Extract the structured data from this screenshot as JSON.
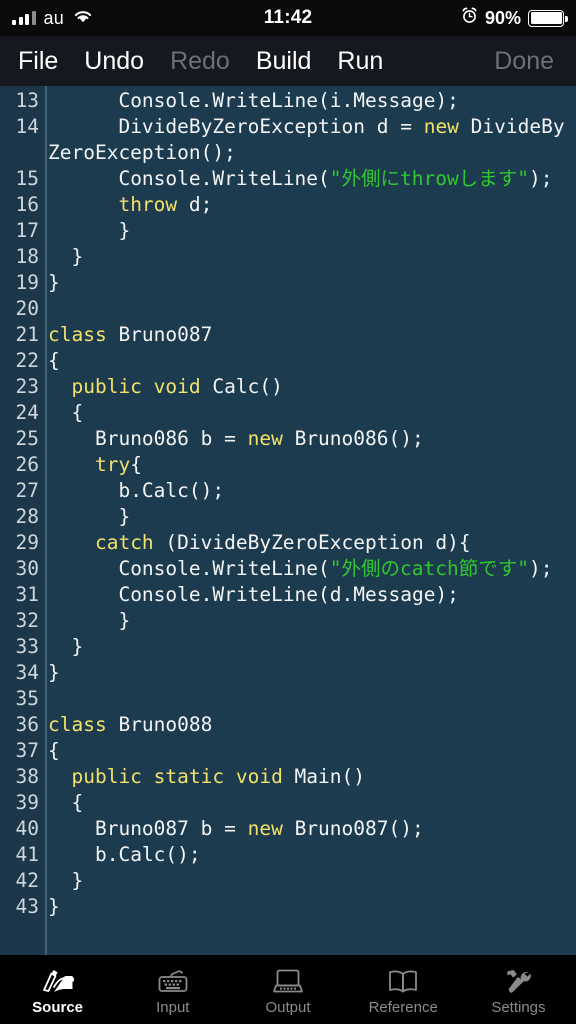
{
  "status_bar": {
    "carrier": "au",
    "time": "11:42",
    "battery_percent": "90%",
    "signal_icon": "signal-bars-icon",
    "wifi_icon": "wifi-icon",
    "alarm_icon": "alarm-clock-icon",
    "battery_icon": "battery-icon",
    "background": "#0a0a0a"
  },
  "toolbar": {
    "background": "#16181f",
    "items": [
      {
        "label": "File",
        "enabled": true
      },
      {
        "label": "Undo",
        "enabled": true
      },
      {
        "label": "Redo",
        "enabled": false
      },
      {
        "label": "Build",
        "enabled": true
      },
      {
        "label": "Run",
        "enabled": true
      }
    ],
    "done_label": "Done",
    "done_enabled": false
  },
  "editor": {
    "background": "#1d3b4e",
    "gutter_background": "#1b3749",
    "keyword_color": "#f2e06a",
    "string_color": "#2fc72f",
    "text_color": "#f2f4f5",
    "line_number_color": "#cfd6da",
    "language": "C#",
    "first_visible_line": 13,
    "last_visible_line": 43,
    "lines": [
      {
        "n": "13",
        "tokens": [
          {
            "t": "p",
            "v": "      Console.WriteLine(i.Message);"
          }
        ]
      },
      {
        "n": "14",
        "tokens": [
          {
            "t": "p",
            "v": "      DivideByZeroException d = "
          },
          {
            "t": "k",
            "v": "new"
          },
          {
            "t": "p",
            "v": " DivideByZeroException();"
          }
        ]
      },
      {
        "n": "15",
        "tokens": [
          {
            "t": "p",
            "v": "      Console.WriteLine("
          },
          {
            "t": "s",
            "v": "\"外側にthrowします\""
          },
          {
            "t": "p",
            "v": ");"
          }
        ]
      },
      {
        "n": "16",
        "tokens": [
          {
            "t": "k",
            "v": "      throw"
          },
          {
            "t": "p",
            "v": " d;"
          }
        ]
      },
      {
        "n": "17",
        "tokens": [
          {
            "t": "p",
            "v": "      }"
          }
        ]
      },
      {
        "n": "18",
        "tokens": [
          {
            "t": "p",
            "v": "  }"
          }
        ]
      },
      {
        "n": "19",
        "tokens": [
          {
            "t": "p",
            "v": "}"
          }
        ]
      },
      {
        "n": "20",
        "tokens": [
          {
            "t": "p",
            "v": ""
          }
        ]
      },
      {
        "n": "21",
        "tokens": [
          {
            "t": "k",
            "v": "class"
          },
          {
            "t": "p",
            "v": " Bruno087"
          }
        ]
      },
      {
        "n": "22",
        "tokens": [
          {
            "t": "p",
            "v": "{"
          }
        ]
      },
      {
        "n": "23",
        "tokens": [
          {
            "t": "k",
            "v": "  public void"
          },
          {
            "t": "p",
            "v": " Calc()"
          }
        ]
      },
      {
        "n": "24",
        "tokens": [
          {
            "t": "p",
            "v": "  {"
          }
        ]
      },
      {
        "n": "25",
        "tokens": [
          {
            "t": "p",
            "v": "    Bruno086 b = "
          },
          {
            "t": "k",
            "v": "new"
          },
          {
            "t": "p",
            "v": " Bruno086();"
          }
        ]
      },
      {
        "n": "26",
        "tokens": [
          {
            "t": "k",
            "v": "    try"
          },
          {
            "t": "p",
            "v": "{"
          }
        ]
      },
      {
        "n": "27",
        "tokens": [
          {
            "t": "p",
            "v": "      b.Calc();"
          }
        ]
      },
      {
        "n": "28",
        "tokens": [
          {
            "t": "p",
            "v": "      }"
          }
        ]
      },
      {
        "n": "29",
        "tokens": [
          {
            "t": "k",
            "v": "    catch"
          },
          {
            "t": "p",
            "v": " (DivideByZeroException d){"
          }
        ]
      },
      {
        "n": "30",
        "tokens": [
          {
            "t": "p",
            "v": "      Console.WriteLine("
          },
          {
            "t": "s",
            "v": "\"外側のcatch節です\""
          },
          {
            "t": "p",
            "v": ");"
          }
        ]
      },
      {
        "n": "31",
        "tokens": [
          {
            "t": "p",
            "v": "      Console.WriteLine(d.Message);"
          }
        ]
      },
      {
        "n": "32",
        "tokens": [
          {
            "t": "p",
            "v": "      }"
          }
        ]
      },
      {
        "n": "33",
        "tokens": [
          {
            "t": "p",
            "v": "  }"
          }
        ]
      },
      {
        "n": "34",
        "tokens": [
          {
            "t": "p",
            "v": "}"
          }
        ]
      },
      {
        "n": "35",
        "tokens": [
          {
            "t": "p",
            "v": ""
          }
        ]
      },
      {
        "n": "36",
        "tokens": [
          {
            "t": "k",
            "v": "class"
          },
          {
            "t": "p",
            "v": " Bruno088"
          }
        ]
      },
      {
        "n": "37",
        "tokens": [
          {
            "t": "p",
            "v": "{"
          }
        ]
      },
      {
        "n": "38",
        "tokens": [
          {
            "t": "k",
            "v": "  public static void"
          },
          {
            "t": "p",
            "v": " Main()"
          }
        ]
      },
      {
        "n": "39",
        "tokens": [
          {
            "t": "p",
            "v": "  {"
          }
        ]
      },
      {
        "n": "40",
        "tokens": [
          {
            "t": "p",
            "v": "    Bruno087 b = "
          },
          {
            "t": "k",
            "v": "new"
          },
          {
            "t": "p",
            "v": " Bruno087();"
          }
        ]
      },
      {
        "n": "41",
        "tokens": [
          {
            "t": "p",
            "v": "    b.Calc();"
          }
        ]
      },
      {
        "n": "42",
        "tokens": [
          {
            "t": "p",
            "v": "  }"
          }
        ]
      },
      {
        "n": "43",
        "tokens": [
          {
            "t": "p",
            "v": "}"
          }
        ]
      }
    ]
  },
  "tabbar": {
    "background": "#000000",
    "active_index": 0,
    "tabs": [
      {
        "label": "Source",
        "icon": "writing-hand-icon"
      },
      {
        "label": "Input",
        "icon": "keyboard-icon"
      },
      {
        "label": "Output",
        "icon": "computer-icon"
      },
      {
        "label": "Reference",
        "icon": "open-book-icon"
      },
      {
        "label": "Settings",
        "icon": "hammer-wrench-icon"
      }
    ]
  }
}
